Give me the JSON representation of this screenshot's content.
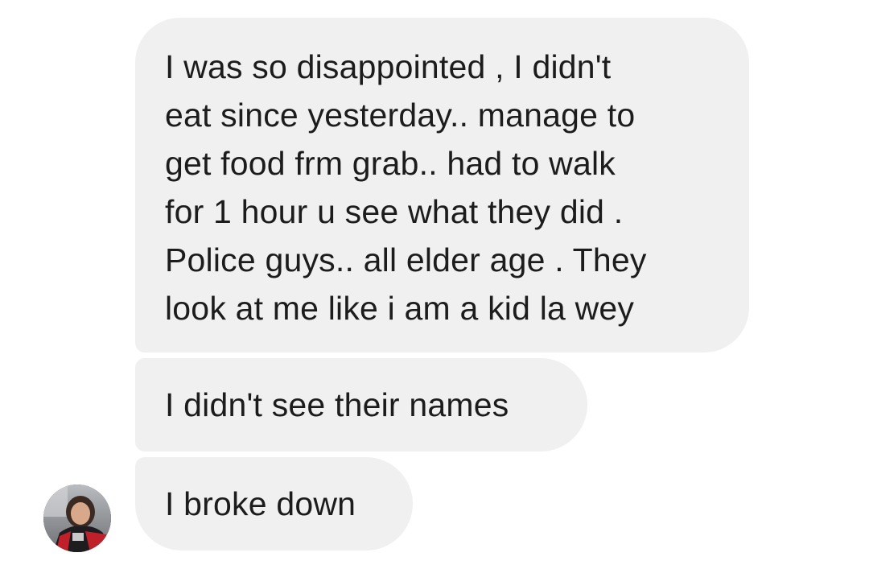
{
  "conversation": {
    "messages": [
      {
        "lines": [
          "I was so disappointed , I didn't",
          "eat since yesterday.. manage to",
          "get food frm grab.. had to walk",
          "for 1 hour u see what they did .",
          "Police guys.. all elder age . They",
          "look at me like i am a kid la wey"
        ]
      },
      {
        "lines": [
          "I didn't see their names"
        ]
      },
      {
        "lines": [
          "I broke down"
        ]
      }
    ],
    "sender": {
      "avatar_icon": "profile-photo"
    }
  },
  "colors": {
    "bubble": "#f0f0f0",
    "text": "#1c1c1c",
    "background": "#ffffff"
  }
}
